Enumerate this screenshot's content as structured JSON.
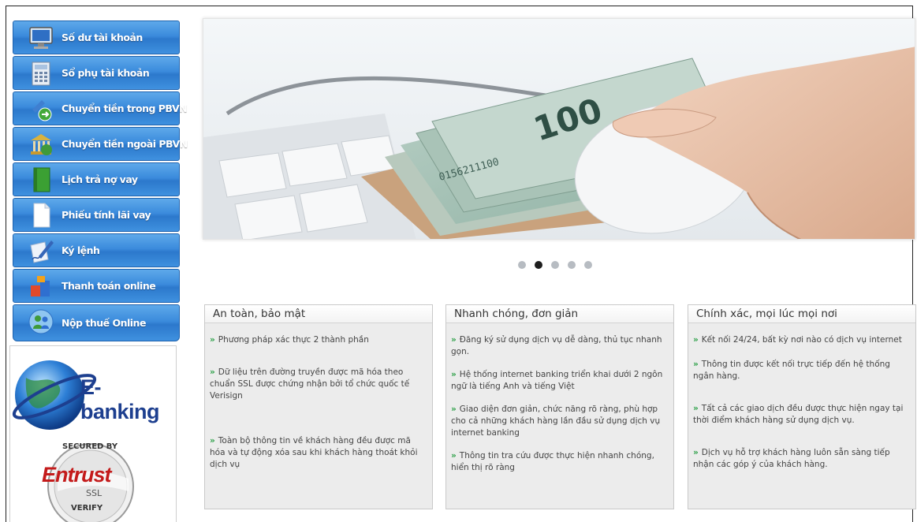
{
  "sidebar": {
    "items": [
      {
        "label": "Số dư tài khoản",
        "icon": "monitor-icon"
      },
      {
        "label": "Sổ phụ tài khoản",
        "icon": "calculator-icon"
      },
      {
        "label": "Chuyển tiền trong PBVN",
        "icon": "money-transfer-icon"
      },
      {
        "label": "Chuyển tiền ngoài PBVN",
        "icon": "bank-building-icon"
      },
      {
        "label": "Lịch trả nợ vay",
        "icon": "green-book-icon"
      },
      {
        "label": "Phiếu tính lãi vay",
        "icon": "document-icon"
      },
      {
        "label": "Ký lệnh",
        "icon": "pen-sign-icon"
      },
      {
        "label": "Thanh toán online",
        "icon": "blocks-icon"
      },
      {
        "label": "Nộp thuế Online",
        "icon": "users-globe-icon"
      }
    ]
  },
  "ebanking": {
    "logo_text": "E-banking",
    "seal": {
      "secured": "SECURED BY",
      "brand": "Entrust",
      "ssl": "SSL",
      "verify": "VERIFY"
    }
  },
  "carousel": {
    "slides": 5,
    "active_index": 1,
    "banner": "hand-on-mouse-with-euro-notes-image"
  },
  "columns": [
    {
      "title": "An toàn, bảo mật",
      "items": [
        "Phương pháp xác thực 2 thành phần",
        "Dữ liệu trên đường truyền được mã hóa theo chuẩn SSL được chứng nhận bởi tổ chức quốc tế Verisign",
        "Toàn bộ thông tin về khách hàng đều được mã hóa và tự động xóa sau khi khách hàng thoát khỏi dịch vụ"
      ]
    },
    {
      "title": "Nhanh chóng, đơn giản",
      "items": [
        "Đăng ký sử dụng dịch vụ dễ dàng, thủ tục nhanh gọn.",
        "Hệ thống internet banking triển khai dưới 2 ngôn ngữ là tiếng Anh và tiếng Việt",
        "Giao diện đơn giản, chức năng rõ ràng, phù hợp cho cả những khách hàng lần đầu sử dụng dịch vụ internet banking",
        "Thông tin tra cứu được thực hiện nhanh chóng, hiển thị rõ ràng"
      ]
    },
    {
      "title": "Chính xác, mọi lúc mọi nơi",
      "items": [
        "Kết nối 24/24, bất kỳ nơi nào có dịch vụ internet",
        "Thông tin được kết nối trực tiếp đến hệ thống ngân hàng.",
        "Tất cả các giao dịch đều được thực hiện ngay tại thời điểm khách hàng sử dụng dịch vụ.",
        "Dịch vụ hỗ trợ khách hàng luôn sẵn sàng tiếp nhận các góp ý của khách hàng."
      ]
    }
  ],
  "bullet_glyph": "»",
  "colors": {
    "menu_blue": "#3b8bdc",
    "bullet_green": "#2fa14a",
    "dot_active": "#1e1e1e",
    "dot_inactive": "#b7bcc2"
  }
}
